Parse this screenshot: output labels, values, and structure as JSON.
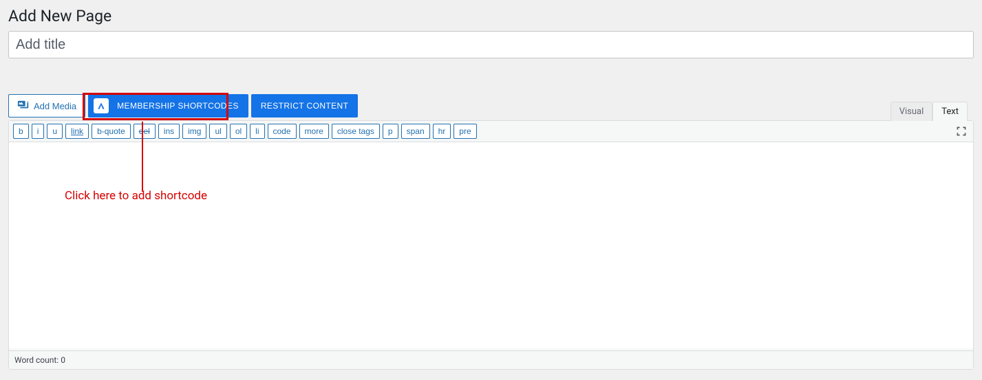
{
  "heading": "Add New Page",
  "title_placeholder": "Add title",
  "toolbar": {
    "add_media": "Add Media",
    "membership_shortcodes": "MEMBERSHIP SHORTCODES",
    "restrict_content": "RESTRICT CONTENT"
  },
  "tabs": {
    "visual": "Visual",
    "text": "Text"
  },
  "quicktags": [
    "b",
    "i",
    "u",
    "link",
    "b-quote",
    "del",
    "ins",
    "img",
    "ul",
    "ol",
    "li",
    "code",
    "more",
    "close tags",
    "p",
    "span",
    "hr",
    "pre"
  ],
  "status": {
    "word_count_label": "Word count:",
    "word_count": "0"
  },
  "annotation": "Click here to add shortcode"
}
